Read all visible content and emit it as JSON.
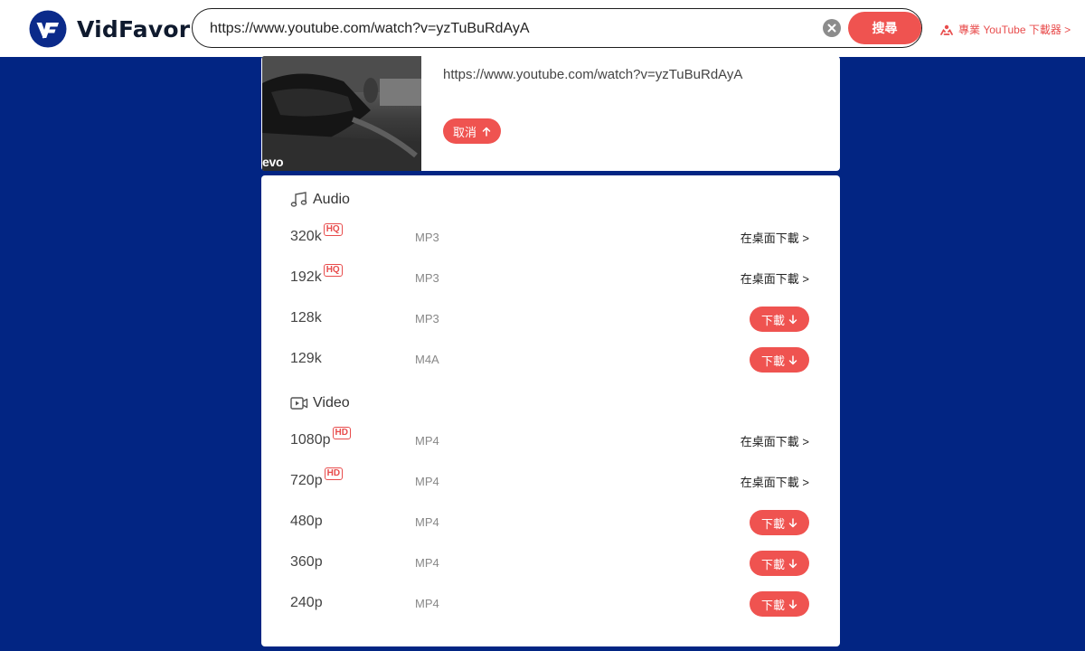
{
  "header": {
    "brand": "VidFavor",
    "search_value": "https://www.youtube.com/watch?v=yzTuBuRdAyA",
    "search_button": "搜尋",
    "pro_link": "專業 YouTube 下載器 >"
  },
  "video": {
    "thumb_watermark": "evo",
    "url": "https://www.youtube.com/watch?v=yzTuBuRdAyA",
    "cancel_label": "取消"
  },
  "audio": {
    "heading": "Audio",
    "rows": [
      {
        "quality": "320k",
        "badge": "HQ",
        "format": "MP3",
        "action": "在桌面下載 >"
      },
      {
        "quality": "192k",
        "badge": "HQ",
        "format": "MP3",
        "action": "在桌面下載 >"
      },
      {
        "quality": "128k",
        "badge": "",
        "format": "MP3",
        "action": "下載"
      },
      {
        "quality": "129k",
        "badge": "",
        "format": "M4A",
        "action": "下載"
      }
    ]
  },
  "videoFormats": {
    "heading": "Video",
    "rows": [
      {
        "quality": "1080p",
        "badge": "HD",
        "format": "MP4",
        "action": "在桌面下載 >"
      },
      {
        "quality": "720p",
        "badge": "HD",
        "format": "MP4",
        "action": "在桌面下載 >"
      },
      {
        "quality": "480p",
        "badge": "",
        "format": "MP4",
        "action": "下載"
      },
      {
        "quality": "360p",
        "badge": "",
        "format": "MP4",
        "action": "下載"
      },
      {
        "quality": "240p",
        "badge": "",
        "format": "MP4",
        "action": "下載"
      }
    ]
  },
  "colors": {
    "background": "#022583",
    "accent": "#ef5350",
    "brand_blue": "#0b2a8a"
  },
  "icons": {
    "logo": "vidfavor-logo-icon",
    "clear": "clear-x-icon",
    "pro": "download-user-icon",
    "cancel": "arrow-up-icon",
    "audio": "music-note-icon",
    "video": "video-camera-icon",
    "download": "arrow-down-icon"
  }
}
